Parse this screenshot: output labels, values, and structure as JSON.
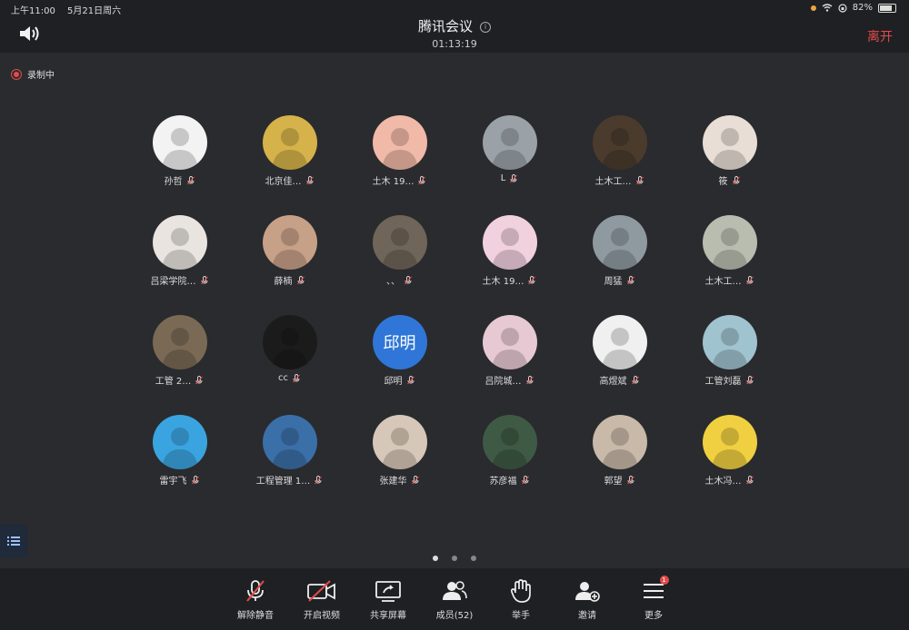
{
  "status": {
    "time": "上午11:00",
    "date": "5月21日周六",
    "battery": "82%",
    "battery_level": 0.82
  },
  "header": {
    "title": "腾讯会议",
    "timer": "01:13:19",
    "leave_label": "离开"
  },
  "recording_label": "录制中",
  "participants": [
    {
      "name": "孙哲",
      "color": "#f3f3f3"
    },
    {
      "name": "北京佳…",
      "color": "#d6b24a"
    },
    {
      "name": "土木 19…",
      "color": "#f1b9a8"
    },
    {
      "name": "L",
      "color": "#9aa2a8"
    },
    {
      "name": "土木工…",
      "color": "#4b3b2d"
    },
    {
      "name": "筱",
      "color": "#e8ded6"
    },
    {
      "name": "吕梁学院…",
      "color": "#e9e4e0"
    },
    {
      "name": "薛楠",
      "color": "#c7a088"
    },
    {
      "name": "、、",
      "color": "#6f6558"
    },
    {
      "name": "土木 19…",
      "color": "#f2d1de"
    },
    {
      "name": "周猛",
      "color": "#8e9aa0"
    },
    {
      "name": "土木工…",
      "color": "#b9bdb0"
    },
    {
      "name": "工管 2…",
      "color": "#7a6a55"
    },
    {
      "name": "cc",
      "color": "#1b1b1b"
    },
    {
      "name": "邱明",
      "color": "#2f76d8",
      "avatar_text": "邱明"
    },
    {
      "name": "吕院城…",
      "color": "#e7c9d3"
    },
    {
      "name": "高煜斌",
      "color": "#f0f0f0"
    },
    {
      "name": "工管刘磊",
      "color": "#9fc3cf"
    },
    {
      "name": "雷宇飞",
      "color": "#3aa4e0"
    },
    {
      "name": "工程管理 1…",
      "color": "#3b6fa8"
    },
    {
      "name": "张建华",
      "color": "#d7c7b8"
    },
    {
      "name": "苏彦福",
      "color": "#3f5a44"
    },
    {
      "name": "郭望",
      "color": "#c8b9a9"
    },
    {
      "name": "土木冯…",
      "color": "#f0d040"
    }
  ],
  "toolbar": {
    "unmute": "解除静音",
    "video": "开启视频",
    "share": "共享屏幕",
    "members": "成员(52)",
    "raise": "举手",
    "invite": "邀请",
    "more": "更多",
    "more_badge": "1"
  }
}
